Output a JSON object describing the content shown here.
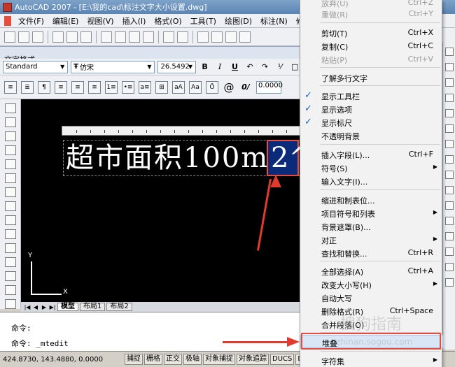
{
  "window": {
    "title": "AutoCAD 2007 - [E:\\我的cad\\标注文字大小设置.dwg]"
  },
  "menubar": [
    "文件(F)",
    "编辑(E)",
    "视图(V)",
    "插入(I)",
    "格式(O)",
    "工具(T)",
    "绘图(D)",
    "标注(N)",
    "修改"
  ],
  "text_format": {
    "title": "文字格式",
    "style": "Standard",
    "font": "仿宋",
    "height": "26.5492",
    "oblique": "0.0000",
    "bold": "B",
    "italic": "I",
    "underline": "U",
    "at_symbol": "@",
    "oblique_label": "0/"
  },
  "canvas": {
    "mtext": "超市面积100m",
    "selected_char": "2^",
    "ucs_x": "X",
    "ucs_y": "Y"
  },
  "tabs": [
    "模型",
    "布局1",
    "布局2"
  ],
  "command": {
    "line1": "命令:",
    "line2": "命令: _mtedit"
  },
  "status": {
    "coords": "424.8730, 143.4880, 0.0000",
    "buttons": [
      "捕捉",
      "栅格",
      "正交",
      "极轴",
      "对象捕捉",
      "对象追踪",
      "DUCS",
      "DYN"
    ]
  },
  "context_menu": {
    "undo": {
      "label": "放弃(U)",
      "shortcut": "Ctrl+Z"
    },
    "redo": {
      "label": "重做(R)",
      "shortcut": "Ctrl+Y"
    },
    "cut": {
      "label": "剪切(T)",
      "shortcut": "Ctrl+X"
    },
    "copy": {
      "label": "复制(C)",
      "shortcut": "Ctrl+C"
    },
    "paste": {
      "label": "粘贴(P)",
      "shortcut": "Ctrl+V"
    },
    "learn": {
      "label": "了解多行文字"
    },
    "show_toolbar": {
      "label": "显示工具栏"
    },
    "show_options": {
      "label": "显示选项"
    },
    "show_ruler": {
      "label": "显示标尺"
    },
    "opaque_bg": {
      "label": "不透明背景"
    },
    "insert_field": {
      "label": "插入字段(L)...",
      "shortcut": "Ctrl+F"
    },
    "symbol": {
      "label": "符号(S)"
    },
    "import_text": {
      "label": "输入文字(I)..."
    },
    "indent_tabs": {
      "label": "缩进和制表位..."
    },
    "bullets": {
      "label": "项目符号和列表"
    },
    "bg_mask": {
      "label": "背景遮罩(B)..."
    },
    "justify": {
      "label": "对正"
    },
    "find_replace": {
      "label": "查找和替换...",
      "shortcut": "Ctrl+R"
    },
    "select_all": {
      "label": "全部选择(A)",
      "shortcut": "Ctrl+A"
    },
    "change_case": {
      "label": "改变大小写(H)"
    },
    "auto_caps": {
      "label": "自动大写"
    },
    "remove_format": {
      "label": "删除格式(R)",
      "shortcut": "Ctrl+Space"
    },
    "combine_para": {
      "label": "合并段落(O)"
    },
    "stack": {
      "label": "堆叠"
    },
    "charset": {
      "label": "字符集"
    }
  },
  "watermark": {
    "main": "搜狗指南",
    "sub": "zhinan.sogou.com"
  },
  "colors": {
    "annotation": "#e03b2e",
    "selection": "#0b2b7a",
    "check": "#1e62c8"
  }
}
